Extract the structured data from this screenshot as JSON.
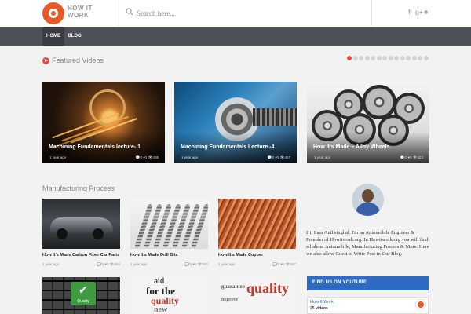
{
  "brand": {
    "logo_text": "HOW IT WORK",
    "accent": "#e85a24"
  },
  "header": {
    "search_placeholder": "Search here...",
    "social": [
      "f",
      "g+",
      "rss"
    ]
  },
  "nav": {
    "items": [
      {
        "label": "HOME",
        "active": true
      },
      {
        "label": "BLOG",
        "active": false
      }
    ]
  },
  "featured": {
    "title": "Featured Videos",
    "slides": 14,
    "active_slide": 0,
    "videos": [
      {
        "title": "Machining Fundamentals lecture- 1",
        "time": "1 year ago",
        "comments": "0",
        "likes": "1",
        "views": "436"
      },
      {
        "title": "Machining Fundamentals Lecture -4",
        "time": "1 year ago",
        "comments": "0",
        "likes": "1",
        "views": "457"
      },
      {
        "title": "How It's Made – Alloy Wheels",
        "time": "1 year ago",
        "comments": "0",
        "likes": "3",
        "views": "423"
      }
    ]
  },
  "manufacturing": {
    "title": "Manufacturing Process",
    "posts": [
      {
        "title": "How It's Made Carbon Fiber Car Parts",
        "time": "1 year ago",
        "comments": "0",
        "likes": "1",
        "views": "654"
      },
      {
        "title": "How It's Made Drill Bits",
        "time": "1 year ago",
        "comments": "0",
        "likes": "1",
        "views": "582"
      },
      {
        "title": "How It's Made Copper",
        "time": "1 year ago",
        "comments": "0",
        "likes": "1",
        "views": "567"
      }
    ],
    "more_images": [
      "Quality",
      "quality",
      "quality"
    ]
  },
  "sidebar": {
    "bio": "Hi, I am Anil singhal. I'm an Automobile Engineer & Founder of Howitwork.org. In Howitwork.org you will find all about Automobile, Manufacturing Process & More. Here we also allow Guest to Write Post in Our Blog.",
    "youtube_title": "FIND US ON YOUTUBE",
    "channel_name": "How It Work",
    "channel_count": "25 videos"
  }
}
